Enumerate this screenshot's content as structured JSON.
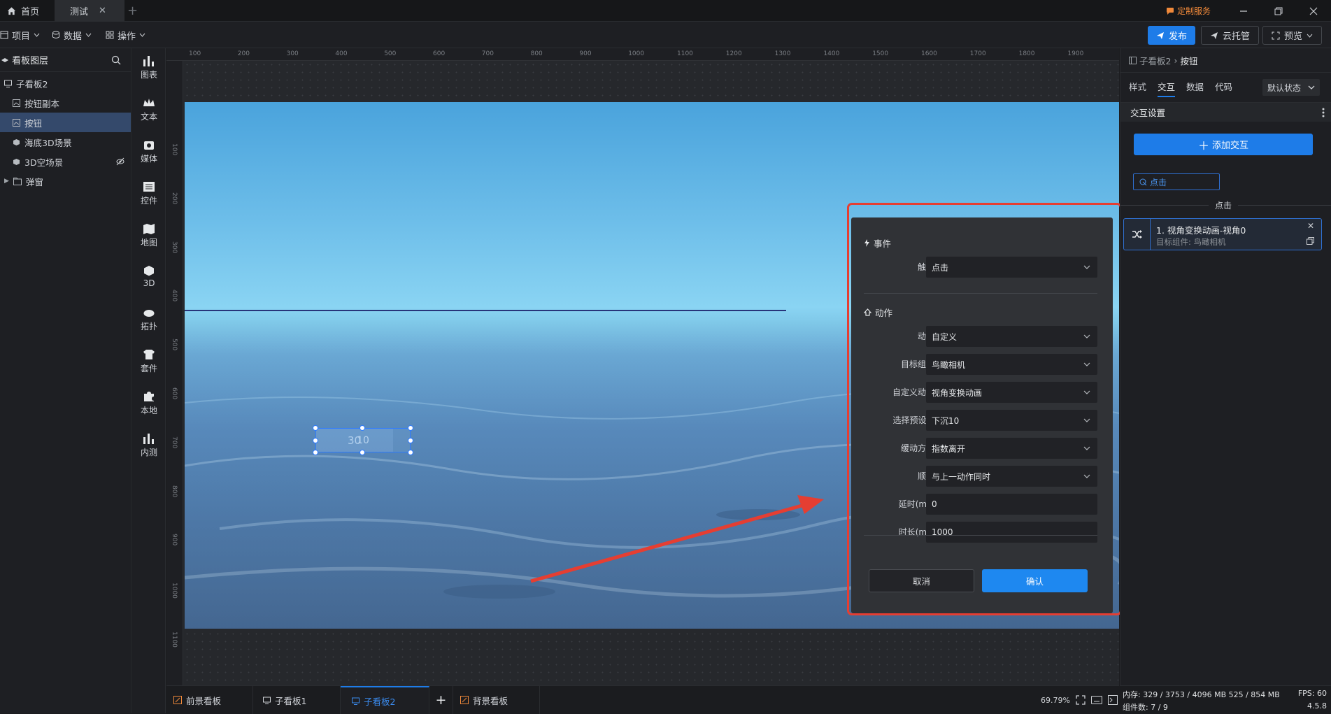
{
  "tabs": {
    "home": "首页",
    "test": "测试",
    "add": "+"
  },
  "top_right": {
    "custom_service": "定制服务"
  },
  "toolbar": {
    "project": "项目",
    "data": "数据",
    "operate": "操作",
    "publish": "发布",
    "cloud": "云托管",
    "preview": "预览"
  },
  "layers": {
    "title": "看板图层",
    "items": [
      {
        "label": "子看板2"
      },
      {
        "label": "按钮副本"
      },
      {
        "label": "按钮"
      },
      {
        "label": "海底3D场景"
      },
      {
        "label": "3D空场景"
      },
      {
        "label": "弹窗"
      }
    ]
  },
  "rail": [
    "图表",
    "文本",
    "媒体",
    "控件",
    "地图",
    "3D",
    "拓扑",
    "套件",
    "本地",
    "内测"
  ],
  "ruler": {
    "top": [
      "100",
      "200",
      "300",
      "400",
      "500",
      "600",
      "700",
      "800",
      "900",
      "1000",
      "1100",
      "1200",
      "1300",
      "1400",
      "1500",
      "1600",
      "1700",
      "1800",
      "1900"
    ],
    "left": [
      "100",
      "200",
      "300",
      "400",
      "500",
      "600",
      "700",
      "800",
      "900",
      "1000",
      "1100"
    ]
  },
  "canvas": {
    "button1_text": "10",
    "button2_text": "30"
  },
  "modal": {
    "event_title": "事件",
    "trigger_label": "触发",
    "trigger_value": "点击",
    "action_title": "动作",
    "fields": [
      {
        "label": "动作",
        "value": "自定义"
      },
      {
        "label": "目标组件",
        "value": "鸟瞰相机"
      },
      {
        "label": "自定义动作",
        "value": "视角变换动画"
      },
      {
        "label": "选择预设...",
        "value": "下沉10"
      },
      {
        "label": "缓动方式",
        "value": "指数离开"
      },
      {
        "label": "顺序",
        "value": "与上一动作同时"
      }
    ],
    "inputs": [
      {
        "label": "延时(ms)",
        "value": "0"
      },
      {
        "label": "时长(ms)",
        "value": "1000"
      }
    ],
    "cancel": "取消",
    "confirm": "确认"
  },
  "right_panel": {
    "breadcrumb_parent": "子看板2",
    "breadcrumb_current": "按钮",
    "tabs": [
      "样式",
      "交互",
      "数据",
      "代码"
    ],
    "state_select": "默认状态",
    "section_title": "交互设置",
    "add_interaction": "添加交互",
    "event_tag": "点击",
    "divider_label": "点击",
    "interaction_title": "1. 视角变换动画-视角0",
    "interaction_sub": "目标组件: 鸟瞰相机"
  },
  "bottom_tabs": [
    "前景看板",
    "子看板1",
    "子看板2",
    "背景看板"
  ],
  "bottom_add": "+",
  "zoom": "69.79%",
  "stats": {
    "memory": "内存: 329 / 3753 / 4096 MB 525 / 854 MB",
    "fps": "FPS: 60",
    "components": "组件数: 7 / 9",
    "version": "4.5.8"
  },
  "colors": {
    "accent": "#1e7ce8",
    "highlight": "#e53e32",
    "selected_layer": "#34496b"
  }
}
